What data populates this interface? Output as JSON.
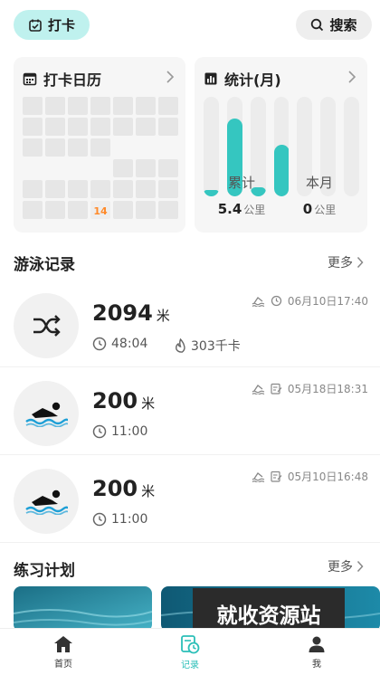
{
  "topbar": {
    "checkin_label": "打卡",
    "search_label": "搜索"
  },
  "calendar_card": {
    "title": "打卡日历",
    "today_label": "14",
    "rows": [
      [
        1,
        1,
        1,
        1,
        1,
        1,
        1
      ],
      [
        1,
        1,
        1,
        1,
        1,
        1,
        1
      ],
      [
        1,
        1,
        1,
        1,
        0,
        0,
        0
      ],
      [
        0,
        0,
        0,
        0,
        1,
        1,
        1
      ],
      [
        1,
        1,
        1,
        1,
        1,
        1,
        1
      ],
      [
        1,
        1,
        1,
        2,
        1,
        1,
        1
      ]
    ]
  },
  "stats_card": {
    "title": "统计(月)",
    "cumulative_label": "累计",
    "cumulative_value": "5.4",
    "cumulative_unit": "公里",
    "month_label": "本月",
    "month_value": "0",
    "month_unit": "公里"
  },
  "chart_data": {
    "type": "bar",
    "title": "",
    "categories": [
      "",
      "",
      "",
      "",
      "",
      "",
      ""
    ],
    "values": [
      0.05,
      0.78,
      0.09,
      0.52,
      0,
      0,
      0
    ],
    "ylim": [
      0,
      1
    ],
    "grid": false
  },
  "swim_section": {
    "title": "游泳记录",
    "more_label": "更多",
    "records": [
      {
        "distance": "2094",
        "unit": "米",
        "duration": "48:04",
        "calories": "303千卡",
        "datetime": "06月10日17:40",
        "icon": "shuffle-icon"
      },
      {
        "distance": "200",
        "unit": "米",
        "duration": "11:00",
        "calories": "",
        "datetime": "05月18日18:31",
        "icon": "swimmer-icon"
      },
      {
        "distance": "200",
        "unit": "米",
        "duration": "11:00",
        "calories": "",
        "datetime": "05月10日16:48",
        "icon": "swimmer-icon"
      }
    ]
  },
  "plan_section": {
    "title": "练习计划",
    "more_label": "更多"
  },
  "watermark": "就收资源站",
  "tabbar": {
    "home": "首页",
    "records": "记录",
    "me": "我"
  },
  "colors": {
    "accent": "#35c6c0",
    "today": "#ff8a2a"
  }
}
